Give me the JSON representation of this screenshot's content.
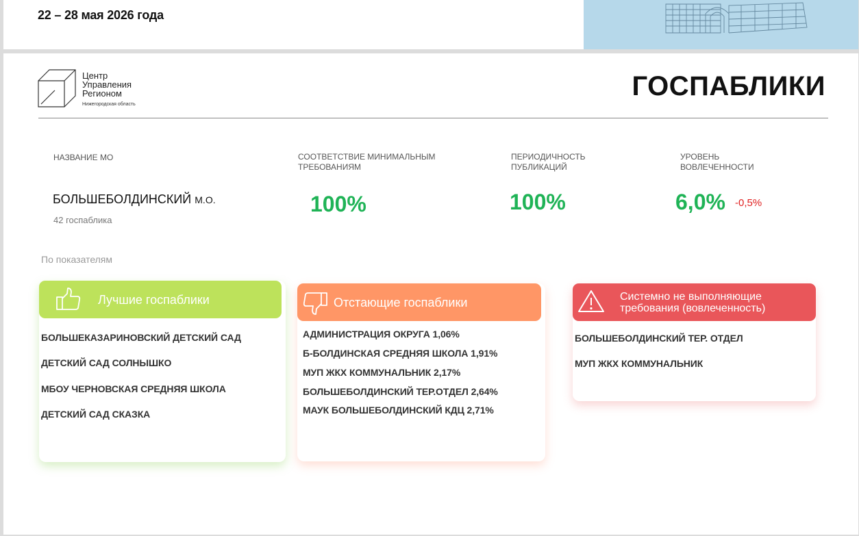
{
  "header": {
    "date": "22 – 28 мая 2026 года"
  },
  "logo": {
    "line1": "Центр",
    "line2": "Управления",
    "line3": "Регионом",
    "region": "Нижегородская область"
  },
  "title": "ГОСПАБЛИКИ",
  "columns": {
    "name": "НАЗВАНИЕ МО",
    "compliance_l1": "СООТВЕТСТВИЕ МИНИМАЛЬНЫМ",
    "compliance_l2": "ТРЕБОВАНИЯМ",
    "periodicity_l1": "ПЕРИОДИЧНОСТЬ",
    "periodicity_l2": "ПУБЛИКАЦИЙ",
    "engagement_l1": "УРОВЕНЬ",
    "engagement_l2": "ВОВЛЕЧЕННОСТИ"
  },
  "mo": {
    "name": "БОЛЬШЕБОЛДИНСКИЙ",
    "suffix": "М.О.",
    "count": "42 госпаблика"
  },
  "metrics": {
    "compliance": "100%",
    "periodicity": "100%",
    "engagement": "6,0%",
    "engagement_delta": "-0,5%"
  },
  "section_label": "По показателям",
  "best": {
    "title": "Лучшие госпаблики",
    "items": [
      "БОЛЬШЕКАЗАРИНОВСКИЙ ДЕТСКИЙ САД",
      "ДЕТСКИЙ САД СОЛНЫШКО",
      "МБОУ ЧЕРНОВСКАЯ СРЕДНЯЯ ШКОЛА",
      "ДЕТСКИЙ САД СКАЗКА"
    ]
  },
  "lagging": {
    "title": "Отстающие госпаблики",
    "items": [
      "АДМИНИСТРАЦИЯ ОКРУГА 1,06%",
      "Б-БОЛДИНСКАЯ СРЕДНЯЯ ШКОЛА 1,91%",
      "МУП ЖКХ КОММУНАЛЬНИК 2,17%",
      "БОЛЬШЕБОЛДИНСКИЙ ТЕР.ОТДЕЛ 2,64%",
      "МАУК БОЛЬШЕБОЛДИНСКИЙ КДЦ 2,71%"
    ]
  },
  "failing": {
    "title_l1": "Системно не выполняющие",
    "title_l2": "требования (вовлеченность)",
    "items": [
      "БОЛЬШЕБОЛДИНСКИЙ ТЕР. ОТДЕЛ",
      "МУП ЖКХ КОММУНАЛЬНИК"
    ]
  },
  "colors": {
    "green_value": "#1fb356",
    "delta_red": "#e02020",
    "best_header": "#bde25b",
    "lagging_header": "#ff9666",
    "failing_header": "#e9565a"
  }
}
